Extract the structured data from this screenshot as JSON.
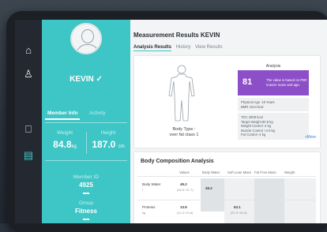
{
  "colors": {
    "accent": "#3ec5c6",
    "score_bg": "#8c4fc7",
    "rail": "#242830"
  },
  "rail": {
    "icons": [
      "home-icon",
      "add-user-icon",
      "monitor-icon",
      "clipboard-icon"
    ]
  },
  "profile": {
    "name": "KEVIN ✓",
    "tabs": [
      "Member Info",
      "Activity"
    ],
    "weight_label": "Weight",
    "weight_value": "84.8",
    "weight_unit": "kg",
    "height_label": "Height",
    "height_value": "187.0",
    "height_unit": "cm",
    "member_id_label": "Member ID",
    "member_id": "4925",
    "group_label": "Group",
    "group": "Fitness"
  },
  "main": {
    "title": "Measurement Results  KEVIN",
    "tabs": [
      "Analysis Results",
      "History",
      "View Results"
    ],
    "body_type_label": "Body Type :",
    "body_type_value": "over fat class 1",
    "analysis_label": "Analysis",
    "score": "81",
    "score_text": "The value is based on PBF, muscle mass and age.",
    "metrics_a": [
      "Physical Age: 19 Years",
      "BMR 1614 kcal"
    ],
    "metrics_b": [
      "TDC 2808 kcal",
      "Target Weight 80.8 kg",
      "Weight Control -4 kg",
      "Muscle Control +4.0 kg",
      "Fat Control -4 kg"
    ],
    "more": "+More"
  },
  "composition": {
    "title": "Body Composition Analysis",
    "headers": [
      "Values",
      "Body Water",
      "Soft Lean Mass",
      "Fat Free Mass",
      "Weight"
    ],
    "rows": [
      {
        "name": "Body Water",
        "unit": "l",
        "value": "49.2",
        "range": "(44.6~47.7)",
        "bw": "49.2"
      },
      {
        "name": "Proteins",
        "unit": "kg",
        "value": "13.9",
        "range": "(11.3~13.6)",
        "slm": "63.1",
        "slm_range": "(57.9~64.3)"
      }
    ]
  }
}
